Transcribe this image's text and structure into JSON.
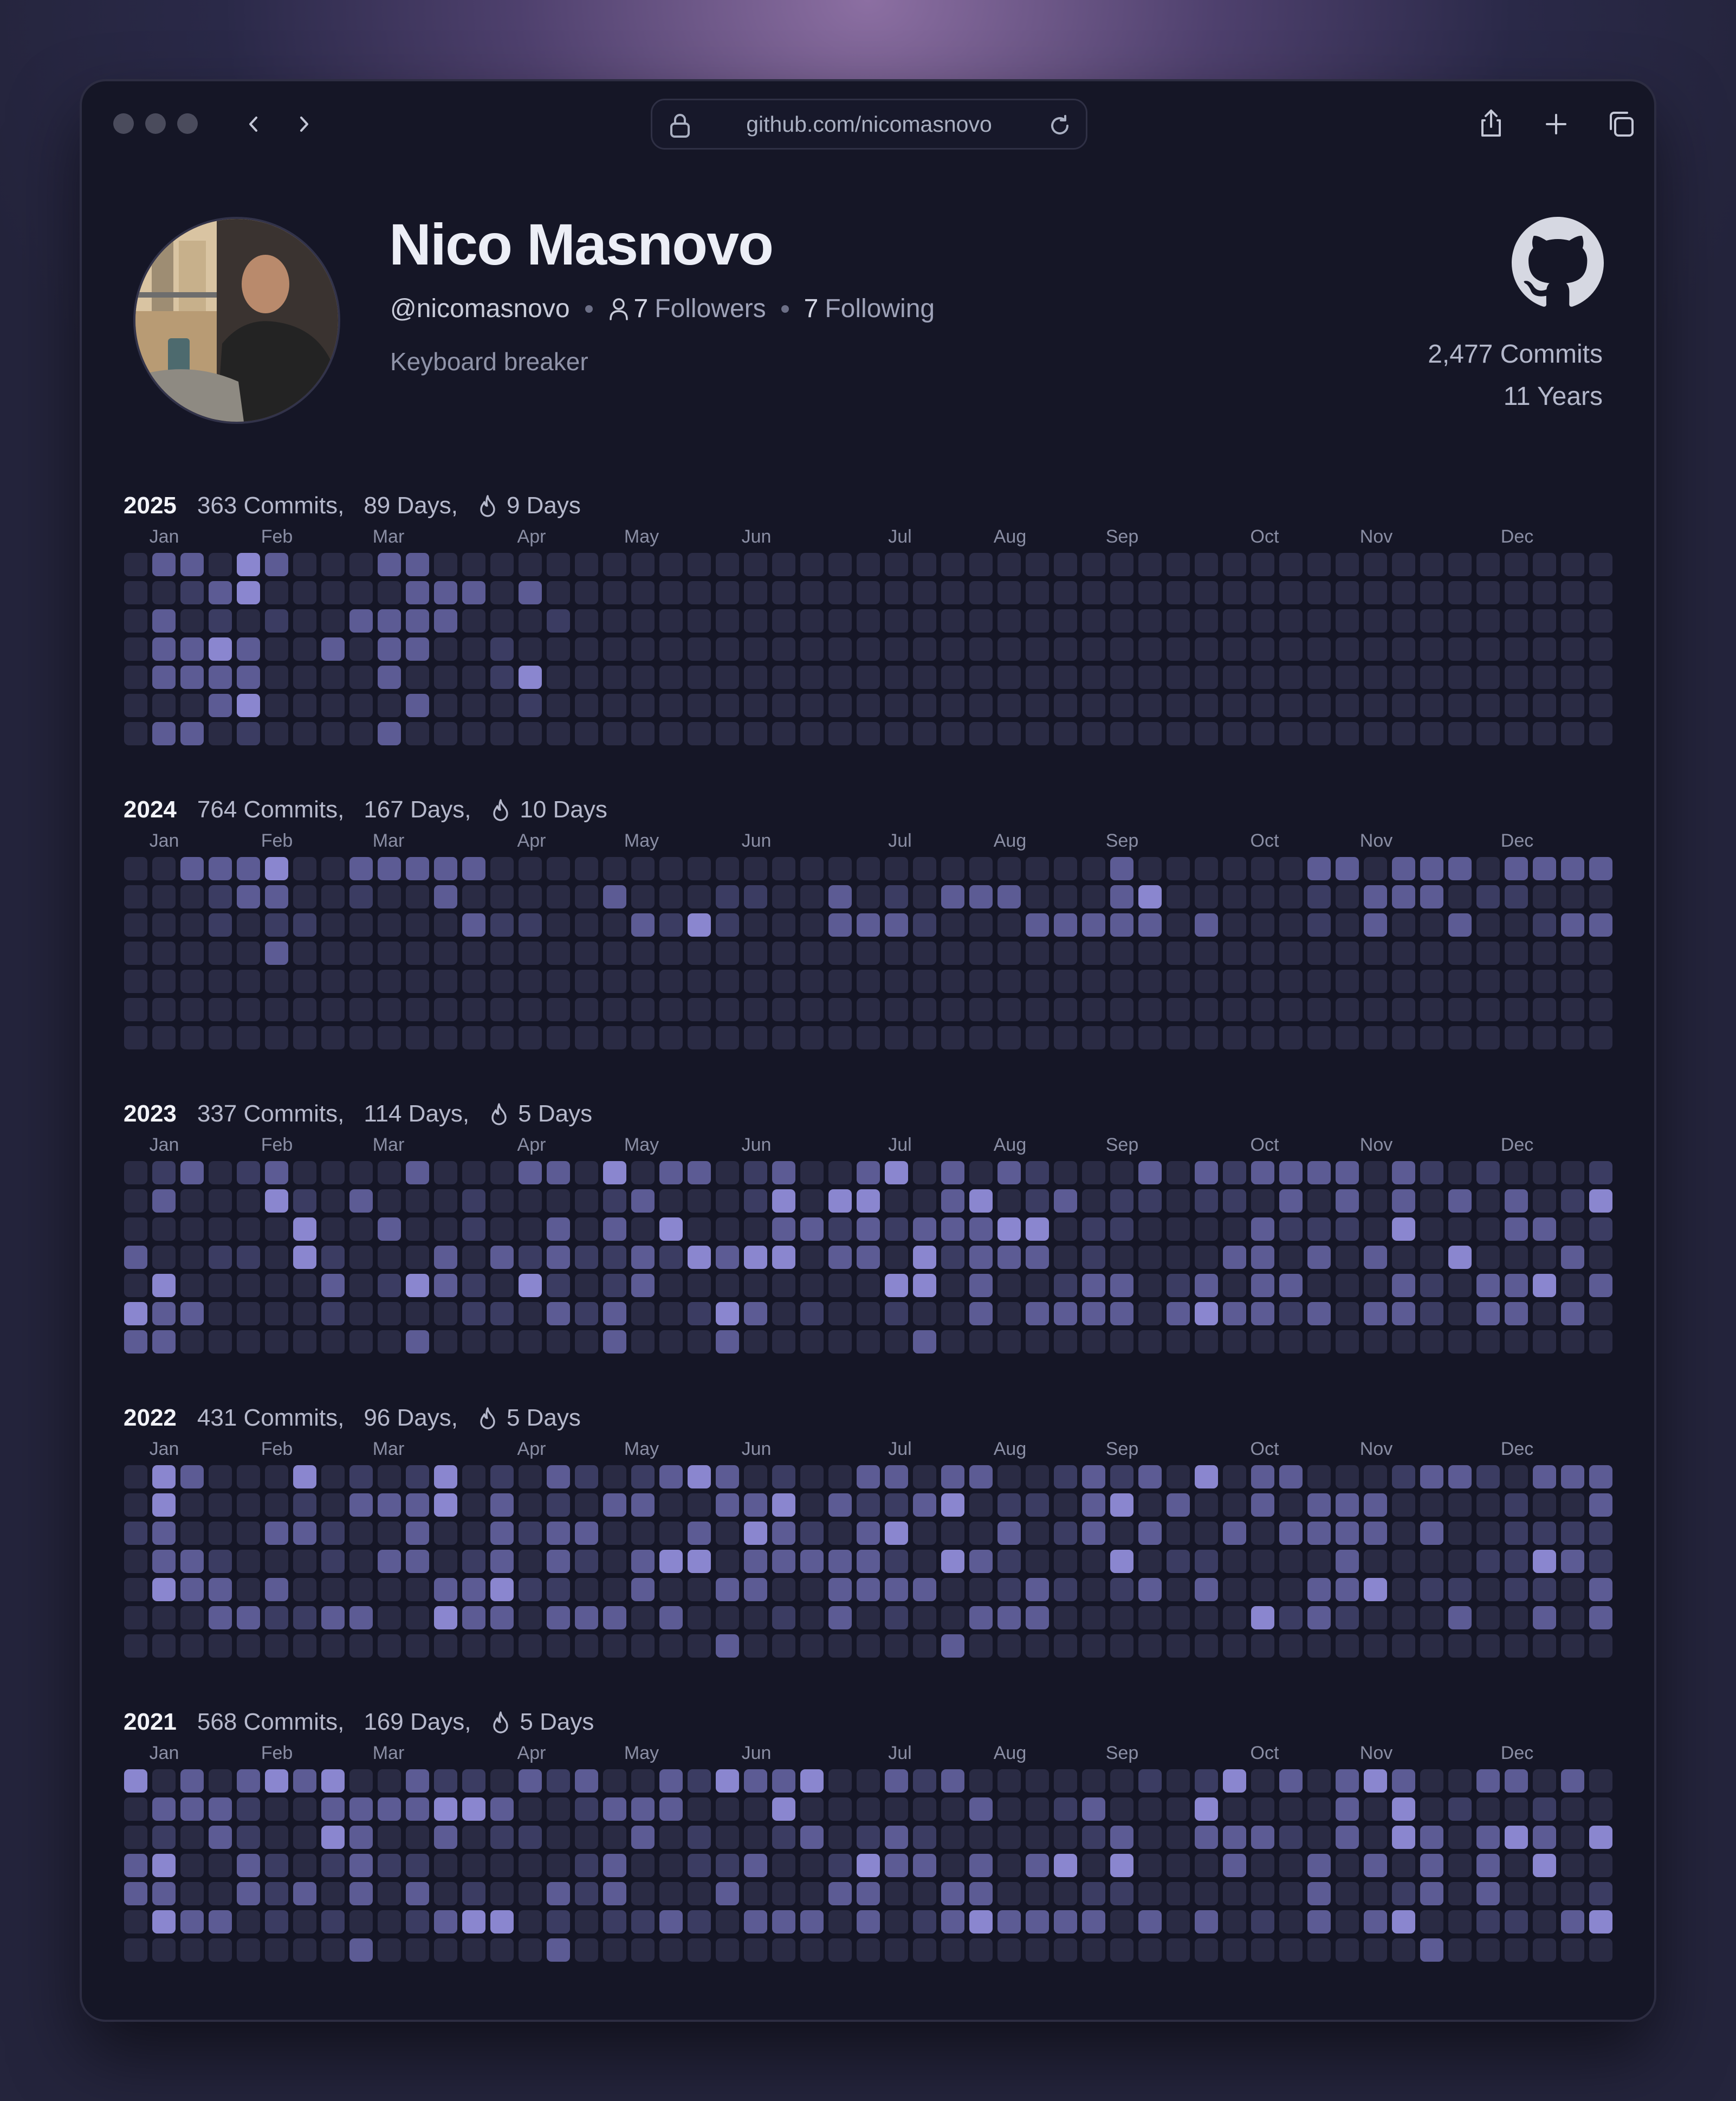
{
  "browser": {
    "url": "github.com/nicomasnovo"
  },
  "profile": {
    "name": "Nico Masnovo",
    "handle": "@nicomasnovo",
    "followers_count": "7",
    "followers_label": "Followers",
    "following_count": "7",
    "following_label": "Following",
    "bio": "Keyboard breaker",
    "total_commits": "2,477 Commits",
    "total_years": "11 Years"
  },
  "icons": [
    "back-icon",
    "forward-icon",
    "lock-icon",
    "reload-icon",
    "share-icon",
    "new-tab-icon",
    "tabs-icon",
    "user-icon",
    "github-logo-icon",
    "flame-icon"
  ],
  "colors": {
    "level0": "#1f2033",
    "level1": "#2a2b44",
    "level2": "#3b3c62",
    "level3": "#5c5b94",
    "level4": "#8a86cf"
  },
  "years": [
    {
      "year": "2025",
      "commits": "363 Commits,",
      "days": "89 Days,",
      "streak": "9 Days",
      "months": [
        "Jan",
        "Feb",
        "Mar",
        "Apr",
        "May",
        "Jun",
        "Jul",
        "Aug",
        "Sep",
        "Oct",
        "Nov",
        "Dec"
      ],
      "weeks_active": 25,
      "grid": [
        "0330430003300000000000000",
        "0023400000333030000000000",
        "0302020033330002000000000",
        "0334300303300200000000000",
        "0333300003000240000000000",
        "0003400000300020000000000",
        "0330200003000000000000000"
      ]
    },
    {
      "year": "2024",
      "commits": "764 Commits,",
      "days": "167 Days,",
      "streak": "10 Days",
      "months": [
        "Jan",
        "Feb",
        "Mar",
        "Apr",
        "May",
        "Jun",
        "Jul",
        "Aug",
        "Sep",
        "Oct",
        "Nov",
        "Dec"
      ],
      "weeks_active": 53,
      "grid": [
        "00333400333330000000000000000000000300000033033303333334",
        "00023300200300000300022003020333000340000020333",
        "00020220000032200032420003332000333330300020300300233200",
        "00000300000000000000000000000000000000000000000000000000",
        "00000000000000000000000000000000000000000000000000000000",
        "00000000000000000000000000000000000000000000000000000000",
        "00000000000000000000000000000000000000000000000000000000"
      ]
    },
    {
      "year": "2023",
      "commits": "337 Commits,",
      "days": "114 Days,",
      "streak": "5 Days",
      "months": [
        "Jan",
        "Feb",
        "Mar",
        "Apr",
        "May",
        "Jun",
        "Jul",
        "Aug",
        "Sep",
        "Oct",
        "Nov",
        "Dec"
      ],
      "weeks_active": 53,
      "grid": []
    },
    {
      "year": "2022",
      "commits": "431 Commits,",
      "days": "96 Days,",
      "streak": "5 Days",
      "months": [
        "Jan",
        "Feb",
        "Mar",
        "Apr",
        "May",
        "Jun",
        "Jul",
        "Aug",
        "Sep",
        "Oct",
        "Nov",
        "Dec"
      ],
      "weeks_active": 53,
      "grid": []
    },
    {
      "year": "2021",
      "commits": "568 Commits,",
      "days": "169 Days,",
      "streak": "5 Days",
      "months": [
        "Jan",
        "Feb",
        "Mar",
        "Apr",
        "May",
        "Jun",
        "Jul",
        "Aug",
        "Sep",
        "Oct",
        "Nov",
        "Dec"
      ],
      "weeks_active": 53,
      "grid": []
    }
  ]
}
